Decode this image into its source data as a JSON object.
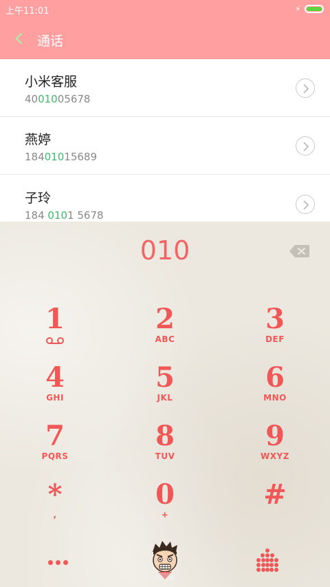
{
  "status": {
    "time": "上午11:01",
    "battery_level": 1.0,
    "battery_color": "#5ed43c",
    "icons": [
      "charging-bolt-icon",
      "battery-icon"
    ]
  },
  "header": {
    "title": "通话",
    "back_icon": "chevron-left-icon"
  },
  "contacts": [
    {
      "name": "小米客服",
      "num_pre": "40",
      "num_hl": "010",
      "num_post": "05678"
    },
    {
      "name": "燕婷",
      "num_pre": "184",
      "num_hl": "010",
      "num_post": "15689"
    },
    {
      "name": "子玲",
      "num_pre": "184 ",
      "num_hl": "010",
      "num_post": "1 5678"
    }
  ],
  "dialer": {
    "typed": "010",
    "keys": [
      {
        "digit": "1",
        "letters": ""
      },
      {
        "digit": "2",
        "letters": "ABC"
      },
      {
        "digit": "3",
        "letters": "DEF"
      },
      {
        "digit": "4",
        "letters": "GHI"
      },
      {
        "digit": "5",
        "letters": "JKL"
      },
      {
        "digit": "6",
        "letters": "MNO"
      },
      {
        "digit": "7",
        "letters": "PQRS"
      },
      {
        "digit": "8",
        "letters": "TUV"
      },
      {
        "digit": "9",
        "letters": "WXYZ"
      },
      {
        "digit": "*",
        "letters": ","
      },
      {
        "digit": "0",
        "letters": "+"
      },
      {
        "digit": "#",
        "letters": ""
      }
    ]
  },
  "colors": {
    "accent": "#ff9f9f",
    "key": "#f05858",
    "match": "#3dbb6a"
  }
}
